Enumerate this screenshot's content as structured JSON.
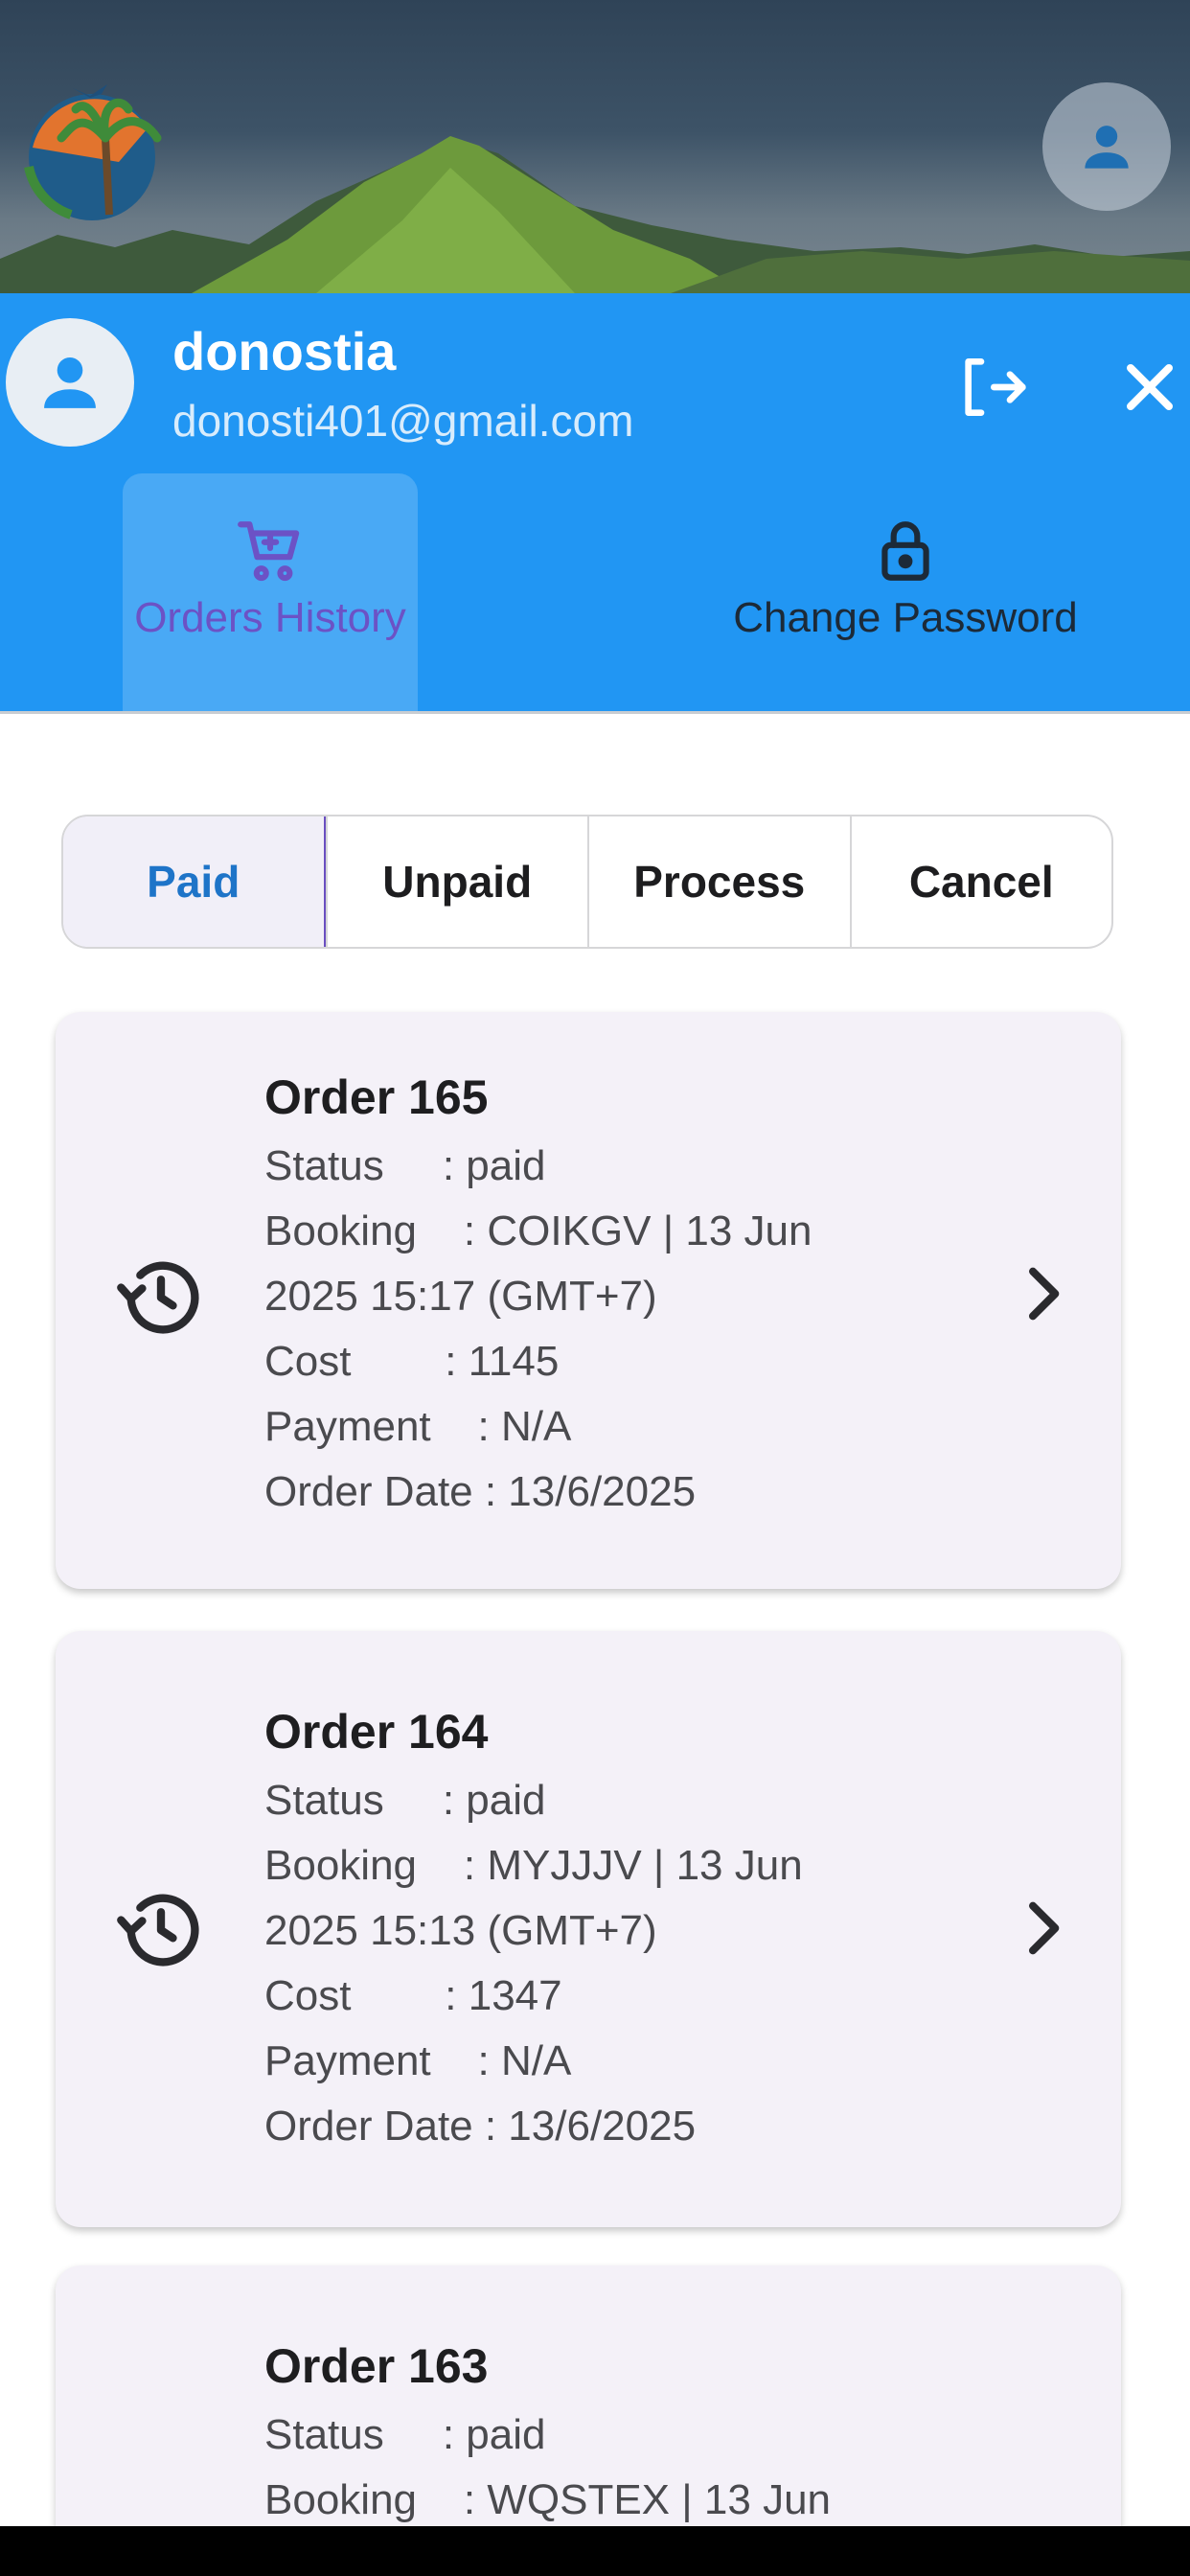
{
  "header": {
    "username": "donostia",
    "email": "donosti401@gmail.com",
    "menu": [
      {
        "label": "Orders History",
        "icon": "cart-icon",
        "active": true
      },
      {
        "label": "Change Password",
        "icon": "lock-icon",
        "active": false
      }
    ]
  },
  "tabs": [
    {
      "label": "Paid",
      "active": true
    },
    {
      "label": "Unpaid",
      "active": false
    },
    {
      "label": "Process",
      "active": false
    },
    {
      "label": "Cancel",
      "active": false
    }
  ],
  "orders": [
    {
      "title": "Order 165",
      "status": "Status     : paid",
      "booking1": "Booking    : COIKGV | 13 Jun",
      "booking2": "2025 15:17 (GMT+7)",
      "cost": "Cost        : 1145",
      "payment": "Payment    : N/A",
      "order_date": "Order Date : 13/6/2025"
    },
    {
      "title": "Order 164",
      "status": "Status     : paid",
      "booking1": "Booking    : MYJJJV | 13 Jun",
      "booking2": "2025 15:13 (GMT+7)",
      "cost": "Cost        : 1347",
      "payment": "Payment    : N/A",
      "order_date": "Order Date : 13/6/2025"
    },
    {
      "title": "Order 163",
      "status": "Status     : paid",
      "booking1": "Booking    : WQSTEX | 13 Jun"
    }
  ],
  "colors": {
    "header_blue": "#2196f3",
    "active_purple": "#6c52c5",
    "active_tab_text": "#1e74c8",
    "card_bg": "#f4f1f8"
  }
}
